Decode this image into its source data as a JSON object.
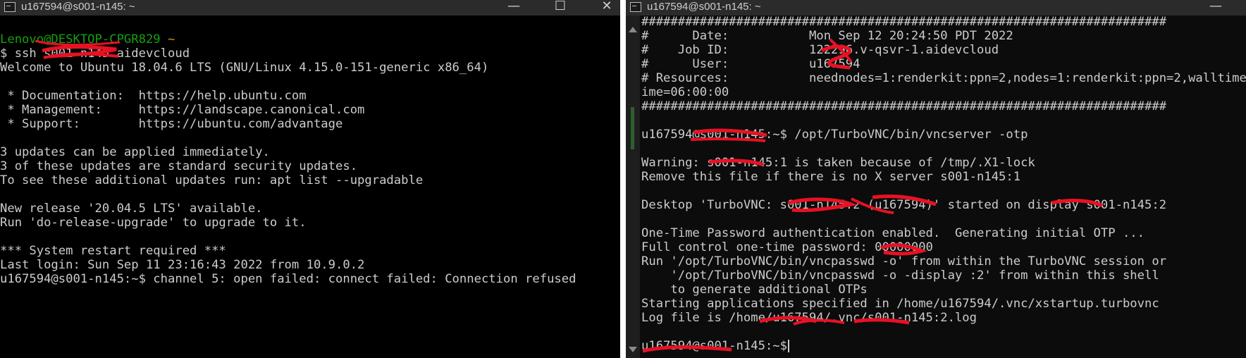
{
  "left_window": {
    "title": "u167594@s001-n145: ~",
    "controls": {
      "minimize": "—",
      "maximize": "☐",
      "close": "✕"
    },
    "lines": [
      {
        "prompt_user": "Lenovo@DESKTOP-CPGR829",
        "prompt_path": " ~"
      },
      {
        "text": "$ ssh s001-n145.aidevcloud"
      },
      {
        "text": "Welcome to Ubuntu 18.04.6 LTS (GNU/Linux 4.15.0-151-generic x86_64)"
      },
      {
        "text": ""
      },
      {
        "text": " * Documentation:  https://help.ubuntu.com"
      },
      {
        "text": " * Management:     https://landscape.canonical.com"
      },
      {
        "text": " * Support:        https://ubuntu.com/advantage"
      },
      {
        "text": ""
      },
      {
        "text": "3 updates can be applied immediately."
      },
      {
        "text": "3 of these updates are standard security updates."
      },
      {
        "text": "To see these additional updates run: apt list --upgradable"
      },
      {
        "text": ""
      },
      {
        "text": "New release '20.04.5 LTS' available."
      },
      {
        "text": "Run 'do-release-upgrade' to upgrade to it."
      },
      {
        "text": ""
      },
      {
        "text": "*** System restart required ***"
      },
      {
        "text": "Last login: Sun Sep 11 23:16:43 2022 from 10.9.0.2"
      },
      {
        "text": "u167594@s001-n145:~$ channel 5: open failed: connect failed: Connection refused"
      }
    ]
  },
  "right_window": {
    "title": "u167594@s001-n145: ~",
    "controls": {
      "minimize": "—"
    },
    "lines": [
      {
        "text": "########################################################################"
      },
      {
        "text": "#      Date:           Mon Sep 12 20:24:50 PDT 2022"
      },
      {
        "text": "#    Job ID:           122296.v-qsvr-1.aidevcloud"
      },
      {
        "text": "#      User:           u167594"
      },
      {
        "text": "# Resources:           neednodes=1:renderkit:ppn=2,nodes=1:renderkit:ppn=2,walltime=06:00:00"
      },
      {
        "text": "ime=06:00:00"
      },
      {
        "text": "########################################################################"
      },
      {
        "text": ""
      },
      {
        "text": "u167594@s001-n145:~$ /opt/TurboVNC/bin/vncserver -otp"
      },
      {
        "text": ""
      },
      {
        "text": "Warning: s001-n145:1 is taken because of /tmp/.X1-lock"
      },
      {
        "text": "Remove this file if there is no X server s001-n145:1"
      },
      {
        "text": ""
      },
      {
        "text": "Desktop 'TurboVNC: s001-n145:2 (u167594)' started on display s001-n145:2"
      },
      {
        "text": ""
      },
      {
        "text": "One-Time Password authentication enabled.  Generating initial OTP ..."
      },
      {
        "text": "Full control one-time password: 00000000"
      },
      {
        "text": "Run '/opt/TurboVNC/bin/vncpasswd -o' from within the TurboVNC session or"
      },
      {
        "text": "    '/opt/TurboVNC/bin/vncpasswd -o -display :2' from within this shell"
      },
      {
        "text": "    to generate additional OTPs"
      },
      {
        "text": "Starting applications specified in /home/u167594/.vnc/xstartup.turbovnc"
      },
      {
        "text": "Log file is /home/u167594/.vnc/s001-n145:2.log"
      },
      {
        "text": ""
      },
      {
        "text": "u167594@s001-n145:~$ "
      }
    ]
  },
  "colors": {
    "terminal_bg": "#000000",
    "text": "#cccccc",
    "prompt_green": "#13a10e",
    "prompt_yellow": "#c19c00",
    "redaction": "#e81123",
    "titlebar": "#2b2b2b"
  }
}
